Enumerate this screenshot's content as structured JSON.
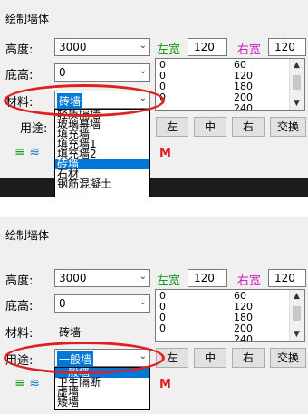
{
  "panels": [
    {
      "title": "绘制墙体",
      "height_label": "高度:",
      "height_value": "3000",
      "left_width_label": "左宽",
      "left_width_value": "120",
      "right_width_label": "右宽",
      "right_width_value": "120",
      "base_label": "底高:",
      "base_value": "0",
      "material_label": "材料:",
      "material_value": "砖墙",
      "usage_label": "用途:",
      "usage_value": "",
      "list_rows": [
        {
          "left": "0",
          "right": "60"
        },
        {
          "left": "0",
          "right": "120"
        },
        {
          "left": "0",
          "right": "180"
        },
        {
          "left": "0",
          "right": "200"
        },
        {
          "left": "",
          "right": "240"
        }
      ],
      "btn_left": "左",
      "btn_center": "中",
      "btn_right": "右",
      "btn_swap": "交换",
      "dropdown_items": [
        "轻质隔墙",
        "玻璃幕墙",
        "填充墙",
        "填充墙1",
        "填充墙2",
        "砖墙",
        "石材",
        "钢筋混凝土"
      ],
      "dropdown_selected": "砖墙",
      "red_letter": "M"
    },
    {
      "title": "绘制墙体",
      "height_label": "高度:",
      "height_value": "3000",
      "left_width_label": "左宽",
      "left_width_value": "120",
      "right_width_label": "右宽",
      "right_width_value": "120",
      "base_label": "底高:",
      "base_value": "0",
      "material_label": "材料:",
      "material_value": "砖墙",
      "usage_label": "用途:",
      "usage_value": "一般墙",
      "list_rows": [
        {
          "left": "0",
          "right": "60"
        },
        {
          "left": "0",
          "right": "120"
        },
        {
          "left": "0",
          "right": "180"
        },
        {
          "left": "0",
          "right": "200"
        },
        {
          "left": "",
          "right": "240"
        }
      ],
      "btn_left": "左",
      "btn_center": "中",
      "btn_right": "右",
      "btn_swap": "交换",
      "dropdown_items": [
        "一般墙",
        "卫生隔断",
        "虚墙",
        "矮墙"
      ],
      "dropdown_selected": "一般墙",
      "red_letter": "M"
    }
  ],
  "colors": {
    "highlight": "#e02020",
    "selection": "#0078d7",
    "left_width": "#1a9a1a",
    "right_width": "#d020c0"
  },
  "icons": [
    "wall-lines-icon",
    "wall-arc-icon"
  ]
}
